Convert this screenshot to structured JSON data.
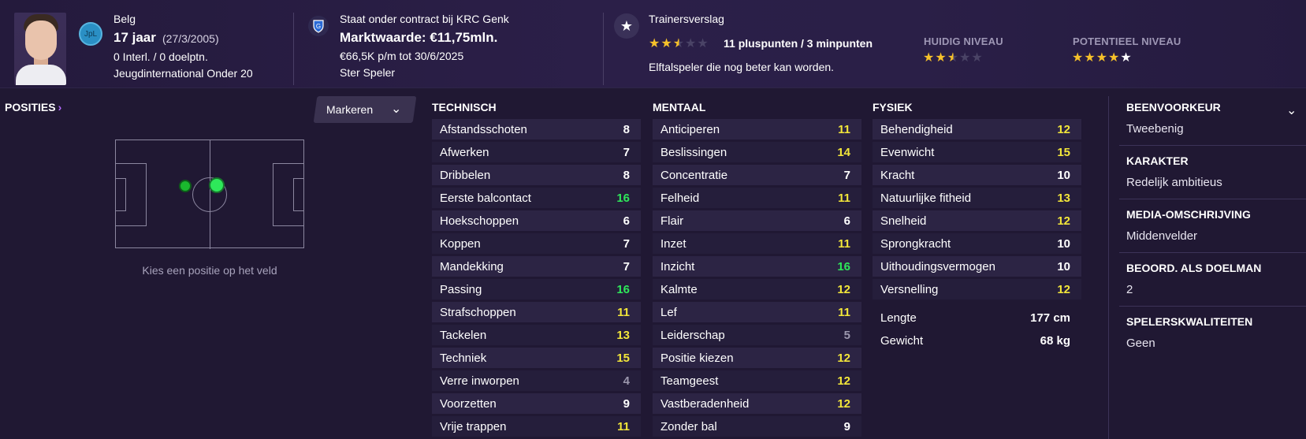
{
  "player": {
    "nationality": "Belg",
    "age": "17 jaar",
    "dob": "(27/3/2005)",
    "caps": "0 Interl. / 0 doelptn.",
    "youth_intl": "Jeugdinternational Onder 20",
    "league_badge": "JpL"
  },
  "contract": {
    "status": "Staat onder contract bij KRC Genk",
    "value": "Marktwaarde: €11,75mln.",
    "wage": "€66,5K p/m tot 30/6/2025",
    "role": "Ster Speler",
    "club_icon": "krc-genk-badge-icon"
  },
  "report": {
    "title": "Trainersverslag",
    "points": "11 pluspunten / 3 minpunten",
    "summary": "Elftalspeler die nog beter kan worden.",
    "report_stars": 2.5,
    "current_label": "HUIDIG NIVEAU",
    "current_stars": 2.5,
    "potential_label": "POTENTIEEL NIVEAU",
    "potential_stars": 4.5,
    "icon": "star-icon"
  },
  "positions": {
    "title": "POSITIES",
    "mark_label": "Markeren",
    "hint": "Kies een positie op het veld"
  },
  "colors": {
    "yellow": "#f2e63a",
    "green": "#2ee85a",
    "star": "#f6c12a",
    "background": "#201833"
  },
  "columns": [
    {
      "title": "TECHNISCH",
      "attributes": [
        {
          "name": "Afstandsschoten",
          "value": "8",
          "tone": "white"
        },
        {
          "name": "Afwerken",
          "value": "7",
          "tone": "white"
        },
        {
          "name": "Dribbelen",
          "value": "8",
          "tone": "white"
        },
        {
          "name": "Eerste balcontact",
          "value": "16",
          "tone": "green"
        },
        {
          "name": "Hoekschoppen",
          "value": "6",
          "tone": "white"
        },
        {
          "name": "Koppen",
          "value": "7",
          "tone": "white"
        },
        {
          "name": "Mandekking",
          "value": "7",
          "tone": "white"
        },
        {
          "name": "Passing",
          "value": "16",
          "tone": "green"
        },
        {
          "name": "Strafschoppen",
          "value": "11",
          "tone": "yellow"
        },
        {
          "name": "Tackelen",
          "value": "13",
          "tone": "yellow"
        },
        {
          "name": "Techniek",
          "value": "15",
          "tone": "yellow"
        },
        {
          "name": "Verre inworpen",
          "value": "4",
          "tone": "grey"
        },
        {
          "name": "Voorzetten",
          "value": "9",
          "tone": "white"
        },
        {
          "name": "Vrije trappen",
          "value": "11",
          "tone": "yellow"
        }
      ]
    },
    {
      "title": "MENTAAL",
      "attributes": [
        {
          "name": "Anticiperen",
          "value": "11",
          "tone": "yellow"
        },
        {
          "name": "Beslissingen",
          "value": "14",
          "tone": "yellow"
        },
        {
          "name": "Concentratie",
          "value": "7",
          "tone": "white"
        },
        {
          "name": "Felheid",
          "value": "11",
          "tone": "yellow"
        },
        {
          "name": "Flair",
          "value": "6",
          "tone": "white"
        },
        {
          "name": "Inzet",
          "value": "11",
          "tone": "yellow"
        },
        {
          "name": "Inzicht",
          "value": "16",
          "tone": "green"
        },
        {
          "name": "Kalmte",
          "value": "12",
          "tone": "yellow"
        },
        {
          "name": "Lef",
          "value": "11",
          "tone": "yellow"
        },
        {
          "name": "Leiderschap",
          "value": "5",
          "tone": "grey"
        },
        {
          "name": "Positie kiezen",
          "value": "12",
          "tone": "yellow"
        },
        {
          "name": "Teamgeest",
          "value": "12",
          "tone": "yellow"
        },
        {
          "name": "Vastberadenheid",
          "value": "12",
          "tone": "yellow"
        },
        {
          "name": "Zonder bal",
          "value": "9",
          "tone": "white"
        }
      ]
    },
    {
      "title": "FYSIEK",
      "attributes": [
        {
          "name": "Behendigheid",
          "value": "12",
          "tone": "yellow"
        },
        {
          "name": "Evenwicht",
          "value": "15",
          "tone": "yellow"
        },
        {
          "name": "Kracht",
          "value": "10",
          "tone": "white"
        },
        {
          "name": "Natuurlijke fitheid",
          "value": "13",
          "tone": "yellow"
        },
        {
          "name": "Snelheid",
          "value": "12",
          "tone": "yellow"
        },
        {
          "name": "Sprongkracht",
          "value": "10",
          "tone": "white"
        },
        {
          "name": "Uithoudingsvermogen",
          "value": "10",
          "tone": "white"
        },
        {
          "name": "Versnelling",
          "value": "12",
          "tone": "yellow"
        }
      ],
      "extras": [
        {
          "name": "Lengte",
          "value": "177 cm"
        },
        {
          "name": "Gewicht",
          "value": "68 kg"
        }
      ]
    }
  ],
  "info": [
    {
      "label": "BEENVOORKEUR",
      "value": "Tweebenig"
    },
    {
      "label": "KARAKTER",
      "value": "Redelijk ambitieus"
    },
    {
      "label": "MEDIA-OMSCHRIJVING",
      "value": "Middenvelder"
    },
    {
      "label": "BEOORD. ALS DOELMAN",
      "value": "2"
    },
    {
      "label": "SPELERSKWALITEITEN",
      "value": "Geen"
    }
  ]
}
